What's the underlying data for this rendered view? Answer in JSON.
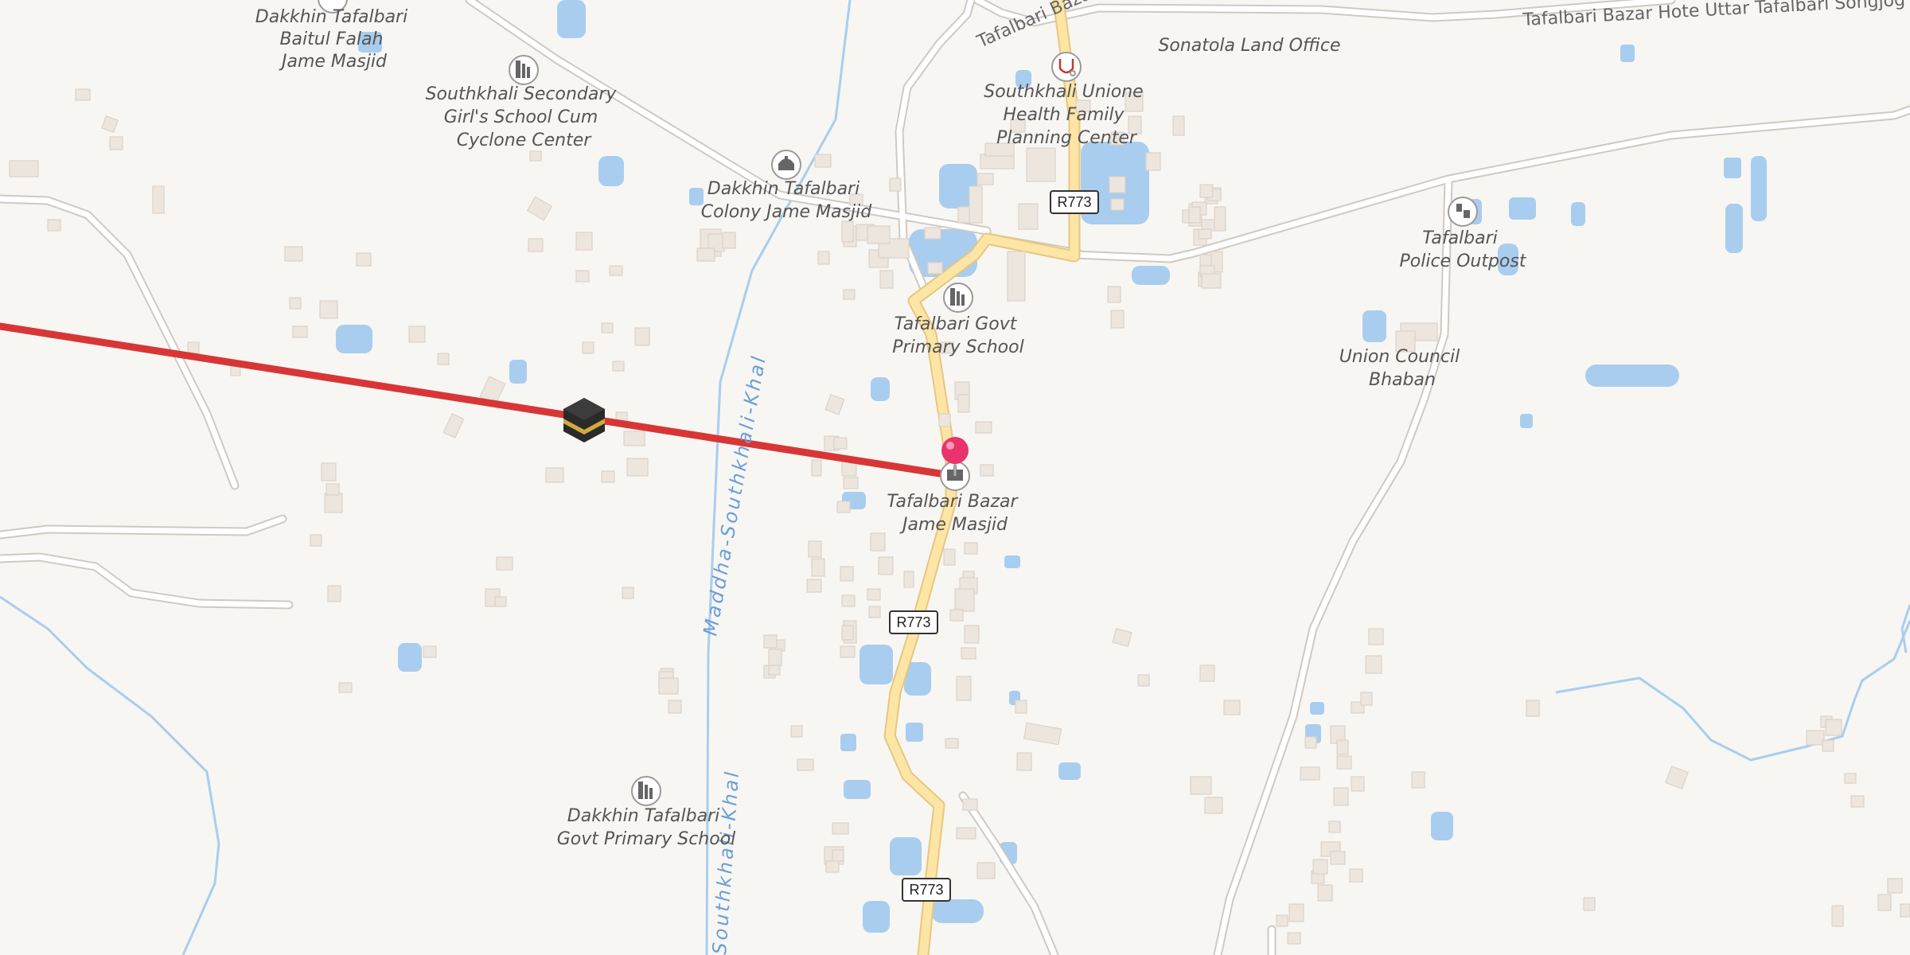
{
  "map": {
    "labels": {
      "baitul": [
        "Dakkhin Tafalbari",
        "Baitul Falah",
        "Jame Masjid"
      ],
      "girls_school": [
        "Southkhali Secondary",
        "Girl's School Cum",
        "Cyclone Center"
      ],
      "colony": [
        "Dakkhin Tafalbari",
        "Colony Jame Masjid"
      ],
      "health": [
        "Southkhali Unione",
        "Health Family",
        "Planning Center"
      ],
      "sonatola": "Sonatola Land Office",
      "police": [
        "Tafalbari",
        "Police Outpost"
      ],
      "govt_primary": [
        "Tafalbari Govt",
        "Primary School"
      ],
      "union_council": [
        "Union Council",
        "Bhaban"
      ],
      "bazar_masjid": [
        "Tafalbari Bazar",
        "Jame Masjid"
      ],
      "dakkhin_school": [
        "Dakkhin Tafalbari",
        "Govt Primary School"
      ]
    },
    "roads": {
      "north_road_1": "Tafalbari Bazar Hote Uttar Tafalbari Songjog Sorok",
      "north_road_2": "Tafalbari Bazar Hote Uttar Tafalbari Songjog Sorok"
    },
    "waterways": {
      "canal": "Maddha-Southkhali-Khal",
      "canal_bottom": "Southkhali-Khal"
    },
    "shields": [
      "R773",
      "R773",
      "R773"
    ],
    "icons": {
      "mosque": "mosque-icon",
      "school": "school-icon",
      "hospital": "stethoscope-icon",
      "police": "police-icon",
      "kaaba": "kaaba-icon",
      "pin": "location-pin-icon"
    },
    "colors": {
      "background": "#f8f6f3",
      "primary_road": "#fde5a5",
      "route_line": "#d83636",
      "water": "#a9cdee",
      "pin": "#e8336d"
    }
  }
}
